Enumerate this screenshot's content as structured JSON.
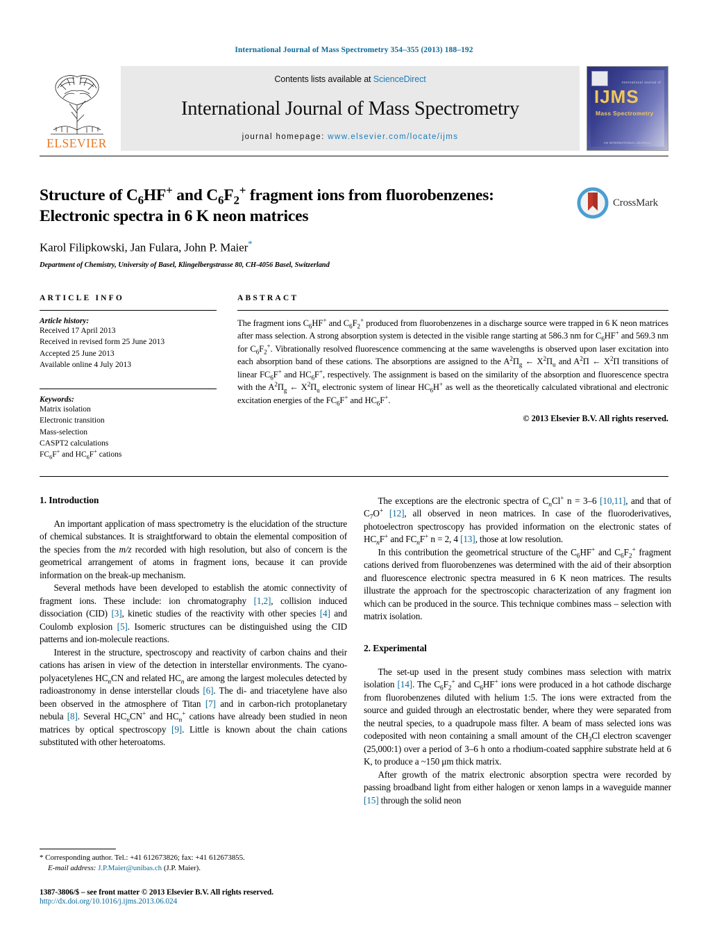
{
  "running_head": "International Journal of Mass Spectrometry 354–355 (2013) 188–192",
  "masthead": {
    "publisher": "ELSEVIER",
    "contents_prefix": "Contents lists available at ",
    "sciencedirect": "ScienceDirect",
    "journal_name": "International Journal of Mass Spectrometry",
    "homepage_prefix": "journal homepage: ",
    "homepage_url": "www.elsevier.com/locate/ijms",
    "cover": {
      "title_mark": "IJMS",
      "subtitle": "Mass Spectrometry",
      "top_text": "International Journal of",
      "bottom_text": "AN INTERNATIONAL JOURNAL"
    }
  },
  "article": {
    "title_line1": "Structure of C",
    "title_full": "Structure of C6HF+ and C6F2+ fragment ions from fluorobenzenes: Electronic spectra in 6 K neon matrices",
    "authors": "Karol Filipkowski, Jan Fulara, John P. Maier",
    "corresponding_star": "*",
    "affiliation": "Department of Chemistry, University of Basel, Klingelbergstrasse 80, CH-4056 Basel, Switzerland",
    "crossmark_label": "CrossMark"
  },
  "article_info": {
    "heading": "ARTICLE INFO",
    "history_label": "Article history:",
    "history": [
      "Received 17 April 2013",
      "Received in revised form 25 June 2013",
      "Accepted 25 June 2013",
      "Available online 4 July 2013"
    ],
    "keywords_label": "Keywords:",
    "keywords": [
      "Matrix isolation",
      "Electronic transition",
      "Mass-selection",
      "CASPT2 calculations",
      "FC6F+ and HC6F+ cations"
    ]
  },
  "abstract": {
    "heading": "ABSTRACT",
    "copyright": "© 2013 Elsevier B.V. All rights reserved."
  },
  "sections": {
    "introduction_title": "1.  Introduction",
    "experimental_title": "2.  Experimental"
  },
  "footer": {
    "corresponding_marker": "*",
    "corresponding_text": "Corresponding author. Tel.: +41 612673826; fax: +41 612673855.",
    "email_label": "E-mail address:",
    "email": "J.P.Maier@unibas.ch",
    "email_suffix": "(J.P. Maier).",
    "issn_line": "1387-3806/$ – see front matter © 2013 Elsevier B.V. All rights reserved.",
    "doi": "http://dx.doi.org/10.1016/j.ijms.2013.06.024"
  },
  "colors": {
    "link": "#0b6a99",
    "sciencedirect": "#1a7bb9",
    "elsevier_orange": "#E87722",
    "masthead_gray": "#e9e9e9"
  }
}
